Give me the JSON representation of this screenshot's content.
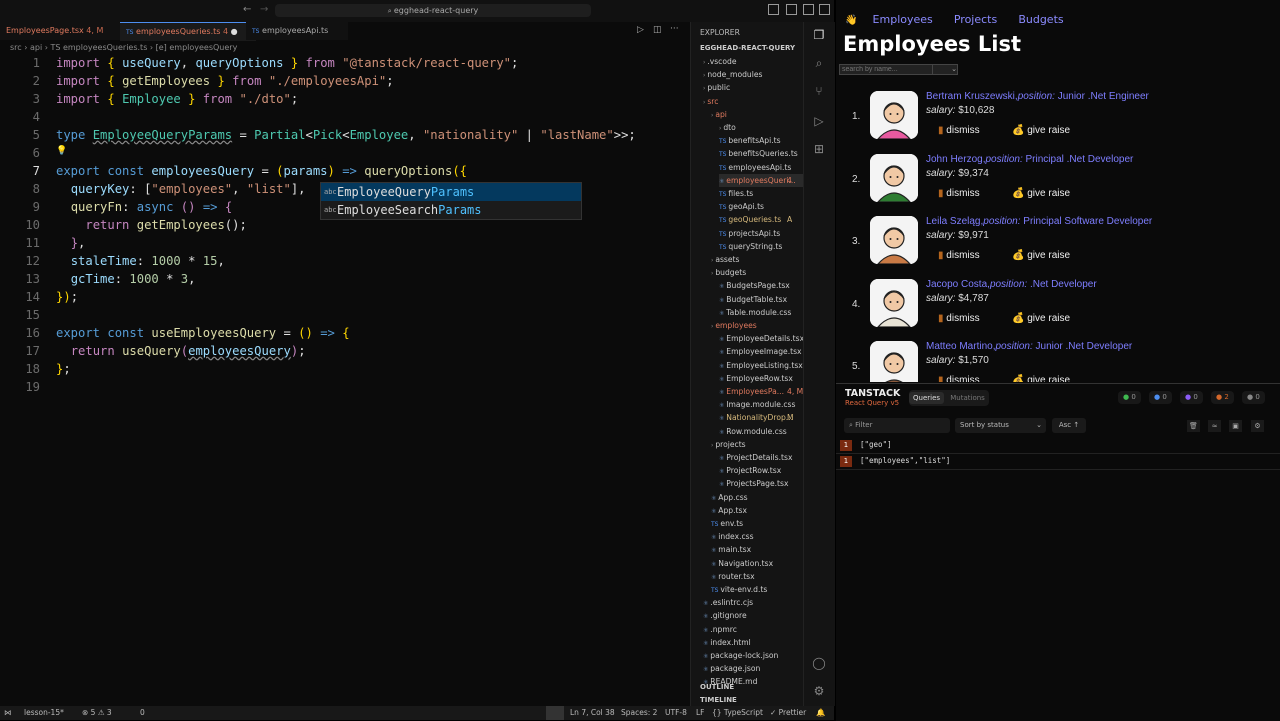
{
  "vscode": {
    "search_text": "egghead-react-query",
    "tabs": [
      {
        "label": "EmployeesPage.tsx",
        "badge": "4, M"
      },
      {
        "label": "employeesQueries.ts",
        "badge": "4"
      },
      {
        "label": "employeesApi.ts",
        "badge": ""
      }
    ],
    "breadcrumb": "src › api › TS employeesQueries.ts › [e] employeesQuery",
    "line_numbers": [
      "1",
      "2",
      "3",
      "4",
      "5",
      "6",
      "7",
      "8",
      "9",
      "10",
      "11",
      "12",
      "13",
      "14",
      "15",
      "16",
      "17",
      "18",
      "19"
    ],
    "suggestions": [
      {
        "prefix": "EmployeeQuery",
        "match": "Params"
      },
      {
        "prefix": "EmployeeSearch",
        "match": "Params"
      }
    ],
    "explorer": {
      "title": "EXPLORER",
      "project": "EGGHEAD-REACT-QUERY",
      "items": [
        ".vscode",
        "node_modules",
        "public",
        "src",
        "api",
        "dto",
        "benefitsApi.ts",
        "benefitsQueries.ts",
        "employeesApi.ts",
        "employeesQueri...",
        "files.ts",
        "geoApi.ts",
        "geoQueries.ts",
        "projectsApi.ts",
        "queryString.ts",
        "assets",
        "budgets",
        "BudgetsPage.tsx",
        "BudgetTable.tsx",
        "Table.module.css",
        "employees",
        "EmployeeDetails.tsx",
        "EmployeeImage.tsx",
        "EmployeeListing.tsx",
        "EmployeeRow.tsx",
        "EmployeesPa...",
        "Image.module.css",
        "NationalityDrop...",
        "Row.module.css",
        "projects",
        "ProjectDetails.tsx",
        "ProjectRow.tsx",
        "ProjectsPage.tsx",
        "App.css",
        "App.tsx",
        "env.ts",
        "index.css",
        "main.tsx",
        "Navigation.tsx",
        "router.tsx",
        "vite-env.d.ts",
        ".eslintrc.cjs",
        ".gitignore",
        ".npmrc",
        "index.html",
        "package-lock.json",
        "package.json",
        "README.md"
      ],
      "badges": {
        "employeesQueri": "4",
        "geoQueries": "A",
        "EmployeesPa": "4, M",
        "NationalityDrop": "M"
      },
      "outline": "OUTLINE",
      "timeline": "TIMELINE"
    },
    "status": {
      "branch": "lesson-15*",
      "problems": "⊗ 5 ⚠ 3",
      "ports": "0",
      "position": "Ln 7, Col 38",
      "spaces": "Spaces: 2",
      "encoding": "UTF-8",
      "eol": "LF",
      "language": "{} TypeScript",
      "formatter": "✓ Prettier"
    }
  },
  "app": {
    "nav": [
      "Employees",
      "Projects",
      "Budgets"
    ],
    "title": "Employees List",
    "search_placeholder": "search by name...",
    "employees": [
      {
        "num": "1.",
        "name": "Bertram Kruszewski,",
        "position": "position:",
        "role": " Junior .Net Engineer",
        "salary_label": "salary:",
        "salary": " $10,628"
      },
      {
        "num": "2.",
        "name": "John Herzog,",
        "position": "position:",
        "role": " Principal .Net Developer",
        "salary_label": "salary:",
        "salary": " $9,374"
      },
      {
        "num": "3.",
        "name": "Leila Szeląg,",
        "position": "position:",
        "role": " Principal Software Developer",
        "salary_label": "salary:",
        "salary": " $9,971"
      },
      {
        "num": "4.",
        "name": "Jacopo Costa,",
        "position": "position:",
        "role": " .Net Developer",
        "salary_label": "salary:",
        "salary": " $4,787"
      },
      {
        "num": "5.",
        "name": "Matteo Martino,",
        "position": "position:",
        "role": " Junior .Net Developer",
        "salary_label": "salary:",
        "salary": " $1,570"
      }
    ],
    "dismiss_label": "dismiss",
    "raise_label": "give raise"
  },
  "devtools": {
    "brand": "TANSTACK",
    "subtitle": "React Query v5",
    "tabs": [
      "Queries",
      "Mutations"
    ],
    "counts": [
      "0",
      "0",
      "0",
      "2",
      "0"
    ],
    "filter_placeholder": "Filter",
    "sort_label": "Sort by status",
    "order_label": "Asc ↑",
    "queries": [
      {
        "count": "1",
        "key": "[\"geo\"]"
      },
      {
        "count": "1",
        "key": "[\"employees\",\"list\"]"
      }
    ]
  },
  "colors": {
    "accent": "#7e7eff",
    "error_count": "#7a2a10",
    "stale_dot": "#d4672a"
  }
}
